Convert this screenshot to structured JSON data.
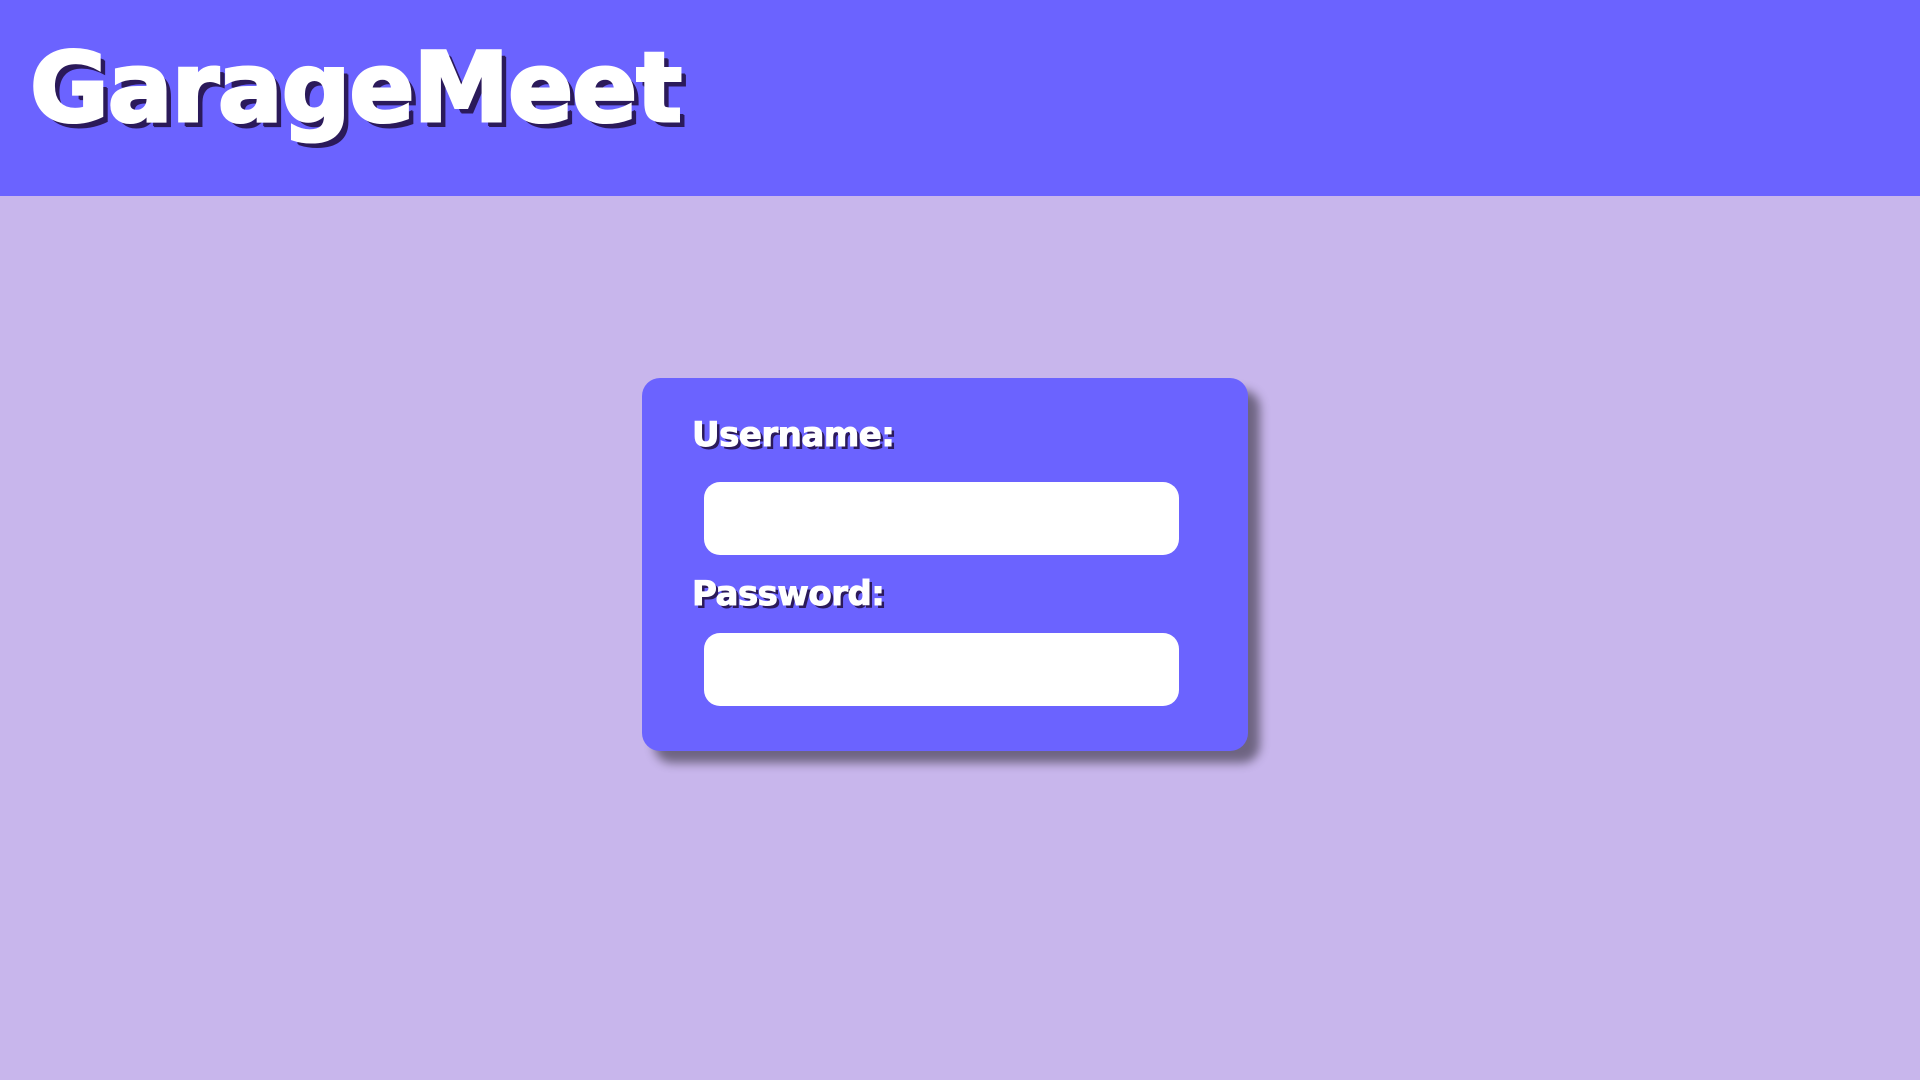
{
  "app": {
    "title": "GarageMeet"
  },
  "login": {
    "username_label": "Username:",
    "username_value": "",
    "username_placeholder": "",
    "password_label": "Password:",
    "password_value": "",
    "password_placeholder": ""
  },
  "colors": {
    "header_bg": "#6b63ff",
    "page_bg": "#c8b6ec",
    "card_bg": "#6b63ff",
    "text_primary": "#ffffff",
    "text_shadow": "#2b1a5a",
    "input_bg": "#ffffff"
  }
}
